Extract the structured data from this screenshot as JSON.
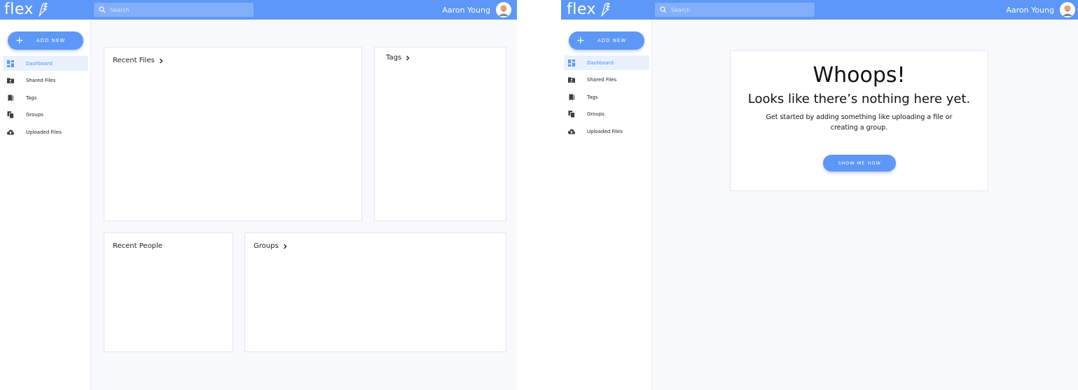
{
  "brand": {
    "name": "flex",
    "accent": "#5d97f7"
  },
  "search": {
    "placeholder": "Search"
  },
  "user": {
    "name": "Aaron Young"
  },
  "sidebar": {
    "add_new_label": "ADD NEW",
    "items": [
      {
        "label": "Dashboard",
        "icon": "dashboard-icon",
        "active": true
      },
      {
        "label": "Shared Files",
        "icon": "shared-folder-icon",
        "active": false
      },
      {
        "label": "Tags",
        "icon": "tag-icon",
        "active": false
      },
      {
        "label": "Groups",
        "icon": "groups-icon",
        "active": false
      },
      {
        "label": "Uploaded Files",
        "icon": "cloud-upload-icon",
        "active": false
      }
    ]
  },
  "dashboard": {
    "recent_files_title": "Recent Files",
    "tags_title": "Tags",
    "recent_people_title": "Recent People",
    "groups_title": "Groups"
  },
  "empty_state": {
    "heading": "Whoops!",
    "subheading": "Looks like there’s nothing here yet.",
    "body": "Get started by adding something like uploading a file or creating a group.",
    "button_label": "SHOW ME HOW"
  }
}
